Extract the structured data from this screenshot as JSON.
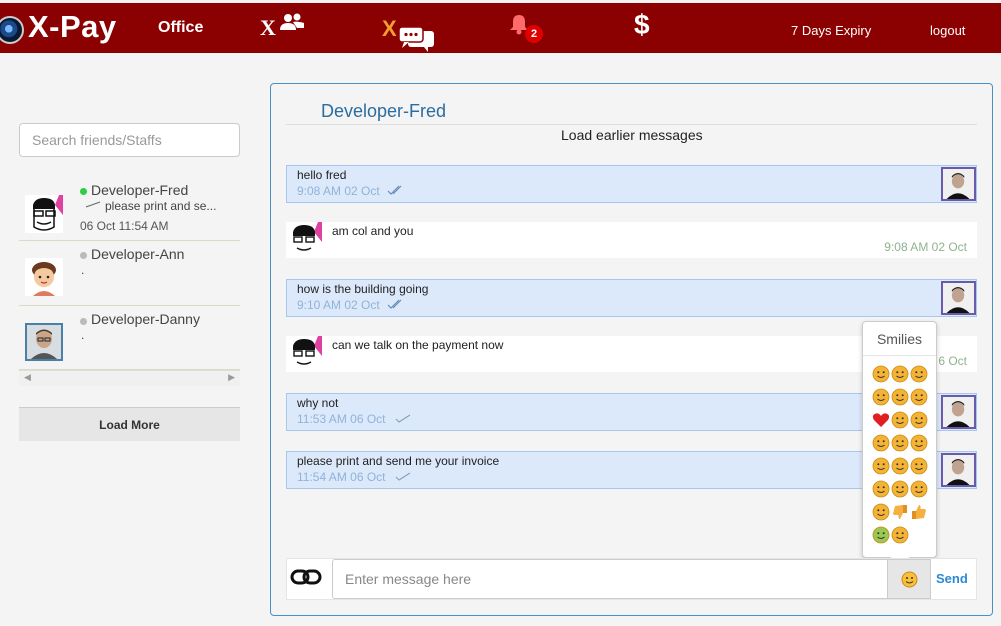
{
  "header": {
    "logo": "X-Pay",
    "office": "Office",
    "x_letter": "X",
    "chat_x": "X",
    "notification_count": "2",
    "dollar": "$",
    "expiry": "7 Days Expiry",
    "logout": "logout",
    "bg_color": "#8b0000"
  },
  "sidebar": {
    "search_placeholder": "Search friends/Staffs",
    "friends": [
      {
        "name": "Developer-Fred",
        "status": "online",
        "last_message": "please print and se...",
        "time": "06 Oct 11:54 AM"
      },
      {
        "name": "Developer-Ann",
        "status": "offline",
        "last_message": "."
      },
      {
        "name": "Developer-Danny",
        "status": "offline",
        "last_message": "."
      }
    ],
    "load_more": "Load More"
  },
  "chat": {
    "title": "Developer-Fred",
    "load_earlier": "Load earlier messages",
    "messages": [
      {
        "dir": "out",
        "text": "hello fred",
        "time": "9:08 AM 02 Oct",
        "ticks": "double"
      },
      {
        "dir": "in",
        "text": "am col and you",
        "time": "9:08 AM 02 Oct"
      },
      {
        "dir": "out",
        "text": "how is the building going",
        "time": "9:10 AM 02 Oct",
        "ticks": "double"
      },
      {
        "dir": "in",
        "text": "can we talk on the payment now",
        "time": "6 Oct"
      },
      {
        "dir": "out",
        "text": "why not",
        "time": "11:53 AM 06 Oct",
        "ticks": "single"
      },
      {
        "dir": "out",
        "text": "please print and send me your invoice",
        "time": "11:54 AM 06 Oct",
        "ticks": "single"
      }
    ],
    "input_placeholder": "Enter message here",
    "send": "Send"
  },
  "smilies": {
    "title": "Smilies",
    "icons": [
      "smile-icon",
      "neutral-icon",
      "sunglasses-icon",
      "sweat-icon",
      "dizzy-icon",
      "devil-icon",
      "heart-icon",
      "grin-icon",
      "heart-eyes-icon",
      "laugh-icon",
      "blush-icon",
      "plain-icon",
      "nerd-icon",
      "tongue-icon",
      "frown-icon",
      "wink-icon",
      "sad-icon",
      "smirk-icon",
      "shocked-icon",
      "thumbs-down-icon",
      "thumbs-up-icon",
      "sick-icon",
      "happy-icon"
    ]
  }
}
